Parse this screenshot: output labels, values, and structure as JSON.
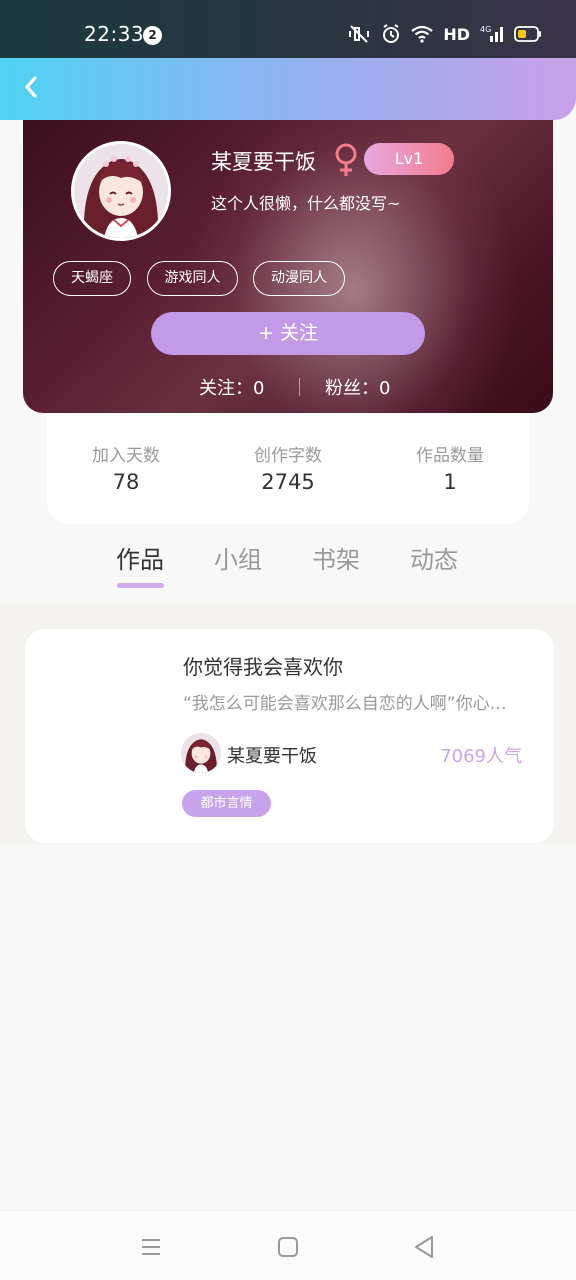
{
  "status_bar": {
    "time": "22:33",
    "notification_count": "2",
    "network_label": "HD",
    "icons": [
      "mute-icon",
      "alarm-icon",
      "wifi-icon",
      "signal-4g-icon",
      "battery-icon"
    ],
    "battery_color": "#f5c518"
  },
  "header": {
    "back_icon": "chevron-left-icon",
    "gradient": [
      "#4fd2f2",
      "#8fb2ef",
      "#c8a0ea"
    ]
  },
  "profile": {
    "username": "某夏要干饭",
    "gender_icon": "female-icon",
    "level": "Lv1",
    "signature": "这个人很懒，什么都没写~",
    "tags": [
      "天蝎座",
      "游戏同人",
      "动漫同人"
    ],
    "follow_button": "+  关注",
    "following": "关注：0",
    "followers": "粉丝：0"
  },
  "stats": [
    {
      "label": "加入天数",
      "value": "78"
    },
    {
      "label": "创作字数",
      "value": "2745"
    },
    {
      "label": "作品数量",
      "value": "1"
    }
  ],
  "tabs": [
    {
      "label": "作品",
      "active": true
    },
    {
      "label": "小组",
      "active": false
    },
    {
      "label": "书架",
      "active": false
    },
    {
      "label": "动态",
      "active": false
    }
  ],
  "works": [
    {
      "title": "你觉得我会喜欢你",
      "excerpt": "“我怎么可能会喜欢那么自恋的人啊”你心…",
      "author": "某夏要干饭",
      "popularity": "7069人气",
      "genre": "都市言情"
    }
  ],
  "nav": [
    "menu-icon",
    "home-square-icon",
    "back-triangle-icon"
  ],
  "accent_color": "#c39ae8"
}
